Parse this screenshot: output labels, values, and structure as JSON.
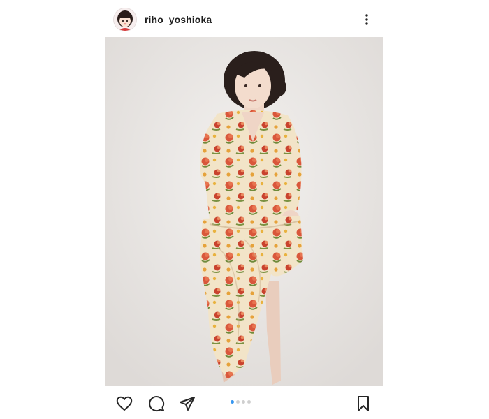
{
  "post": {
    "username": "riho_yoshioka",
    "avatar_icon": "avatar-illustration",
    "photo_icon": "photo-woman-floral-dress",
    "carousel": {
      "total": 4,
      "active_index": 0,
      "active_color": "#3897f0"
    }
  },
  "actions": {
    "like_icon": "heart-icon",
    "comment_icon": "comment-icon",
    "share_icon": "paper-plane-icon",
    "save_icon": "bookmark-icon",
    "more_icon": "more-vertical-icon"
  }
}
